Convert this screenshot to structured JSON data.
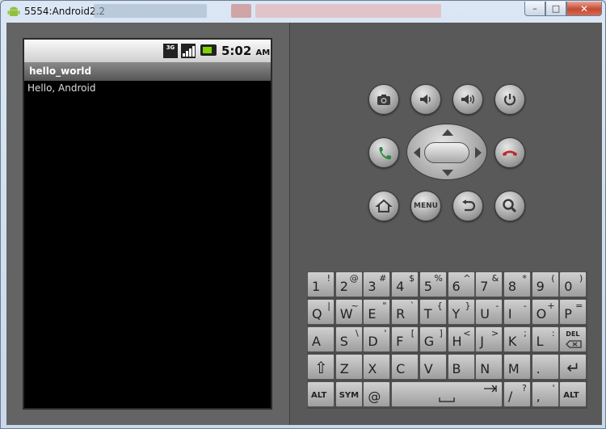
{
  "window": {
    "title": "5554:Android2.2",
    "minimize_glyph": "–",
    "maximize_glyph": "□",
    "close_glyph": "✕"
  },
  "statusbar": {
    "network_badge": "3G",
    "time": "5:02",
    "ampm": "AM"
  },
  "app": {
    "title": "hello_world",
    "body_text": "Hello, Android"
  },
  "hardware": {
    "menu_label": "MENU"
  },
  "colors": {
    "call_green": "#2e8b3a",
    "end_red": "#c0272d",
    "battery_green": "#7fd400",
    "panel_gray": "#595959"
  },
  "keyboard": {
    "rows": [
      [
        {
          "m": "1",
          "a": "!"
        },
        {
          "m": "2",
          "a": "@"
        },
        {
          "m": "3",
          "a": "#"
        },
        {
          "m": "4",
          "a": "$"
        },
        {
          "m": "5",
          "a": "%"
        },
        {
          "m": "6",
          "a": "^"
        },
        {
          "m": "7",
          "a": "&"
        },
        {
          "m": "8",
          "a": "*"
        },
        {
          "m": "9",
          "a": "("
        },
        {
          "m": "0",
          "a": ")"
        }
      ],
      [
        {
          "m": "Q",
          "a": "|"
        },
        {
          "m": "W",
          "a": "~"
        },
        {
          "m": "E",
          "a": "\""
        },
        {
          "m": "R",
          "a": "`"
        },
        {
          "m": "T",
          "a": "{"
        },
        {
          "m": "Y",
          "a": "}"
        },
        {
          "m": "U",
          "a": "-"
        },
        {
          "m": "I",
          "a": "-"
        },
        {
          "m": "O",
          "a": "+"
        },
        {
          "m": "P",
          "a": "="
        }
      ],
      [
        {
          "m": "A",
          "a": ""
        },
        {
          "m": "S",
          "a": "\\"
        },
        {
          "m": "D",
          "a": "'"
        },
        {
          "m": "F",
          "a": "["
        },
        {
          "m": "G",
          "a": "]"
        },
        {
          "m": "H",
          "a": "<"
        },
        {
          "m": "J",
          "a": ">"
        },
        {
          "m": "K",
          "a": ";"
        },
        {
          "m": "L",
          "a": ":"
        },
        {
          "m": "DEL",
          "a": ""
        }
      ],
      [
        {
          "m": "⇧",
          "a": ""
        },
        {
          "m": "Z",
          "a": ""
        },
        {
          "m": "X",
          "a": ""
        },
        {
          "m": "C",
          "a": ""
        },
        {
          "m": "V",
          "a": ""
        },
        {
          "m": "B",
          "a": ""
        },
        {
          "m": "N",
          "a": ""
        },
        {
          "m": "M",
          "a": ""
        },
        {
          "m": ".",
          "a": ""
        },
        {
          "m": "↵",
          "a": ""
        }
      ]
    ],
    "bottom": {
      "alt_left": "ALT",
      "sym": "SYM",
      "at": "@",
      "slash": "/",
      "slash_alt": "?",
      "comma": ",",
      "comma_alt": "'",
      "alt_right": "ALT"
    }
  }
}
